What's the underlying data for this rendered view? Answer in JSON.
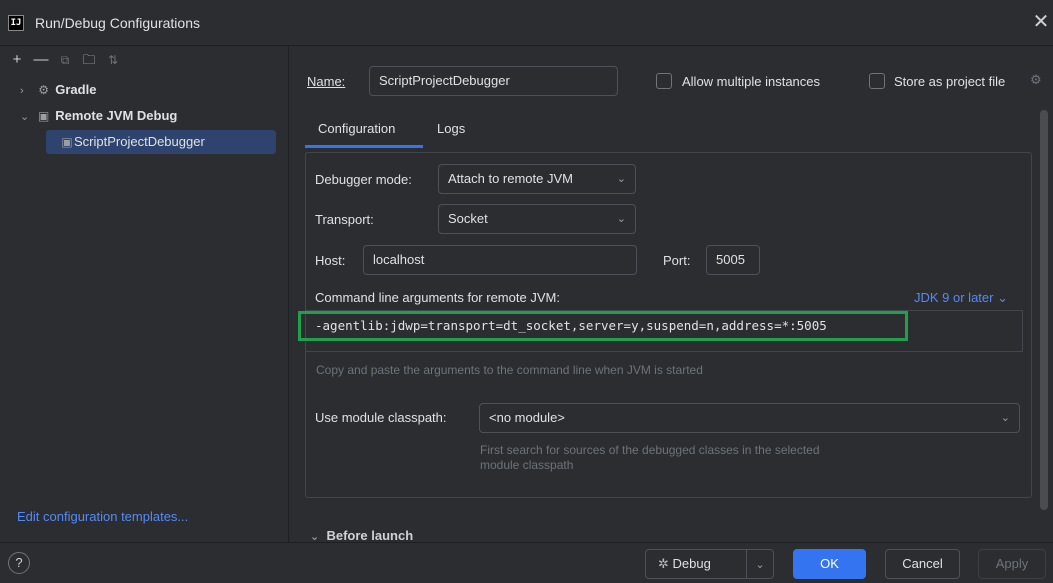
{
  "window": {
    "title": "Run/Debug Configurations",
    "app_icon_text": "IJ"
  },
  "toolbar": {
    "icons": [
      "add-icon",
      "remove-icon",
      "copy-icon",
      "folder-icon",
      "sort-icon"
    ]
  },
  "tree": {
    "gradle": "Gradle",
    "remote_jvm_debug": "Remote JVM Debug",
    "config": "ScriptProjectDebugger"
  },
  "edit_templates": "Edit configuration templates...",
  "form": {
    "name_label": "Name:",
    "name_value": "ScriptProjectDebugger",
    "allow_multiple": "Allow multiple instances",
    "store_as_project_file": "Store as project file",
    "tabs": [
      "Configuration",
      "Logs"
    ],
    "debugger_mode_label": "Debugger mode:",
    "debugger_mode_value": "Attach to remote JVM",
    "transport_label": "Transport:",
    "transport_value": "Socket",
    "host_label": "Host:",
    "host_value": "localhost",
    "port_label": "Port:",
    "port_value": "5005",
    "cmd_args_label": "Command line arguments for remote JVM:",
    "jdk_selector": "JDK 9 or later",
    "cmd_args_value": "-agentlib:jdwp=transport=dt_socket,server=y,suspend=n,address=*:5005",
    "cmd_args_hint": "Copy and paste the arguments to the command line when JVM is started",
    "module_classpath_label": "Use module classpath:",
    "module_classpath_value": "<no module>",
    "module_hint_line1": "First search for sources of the debugged classes in the selected",
    "module_hint_line2": "module classpath",
    "before_launch": "Before launch"
  },
  "buttons": {
    "help": "?",
    "debug": "Debug",
    "ok": "OK",
    "cancel": "Cancel",
    "apply": "Apply"
  },
  "colors": {
    "accent": "#3574f0",
    "highlight_border": "#1ea04c",
    "link": "#548af7"
  }
}
